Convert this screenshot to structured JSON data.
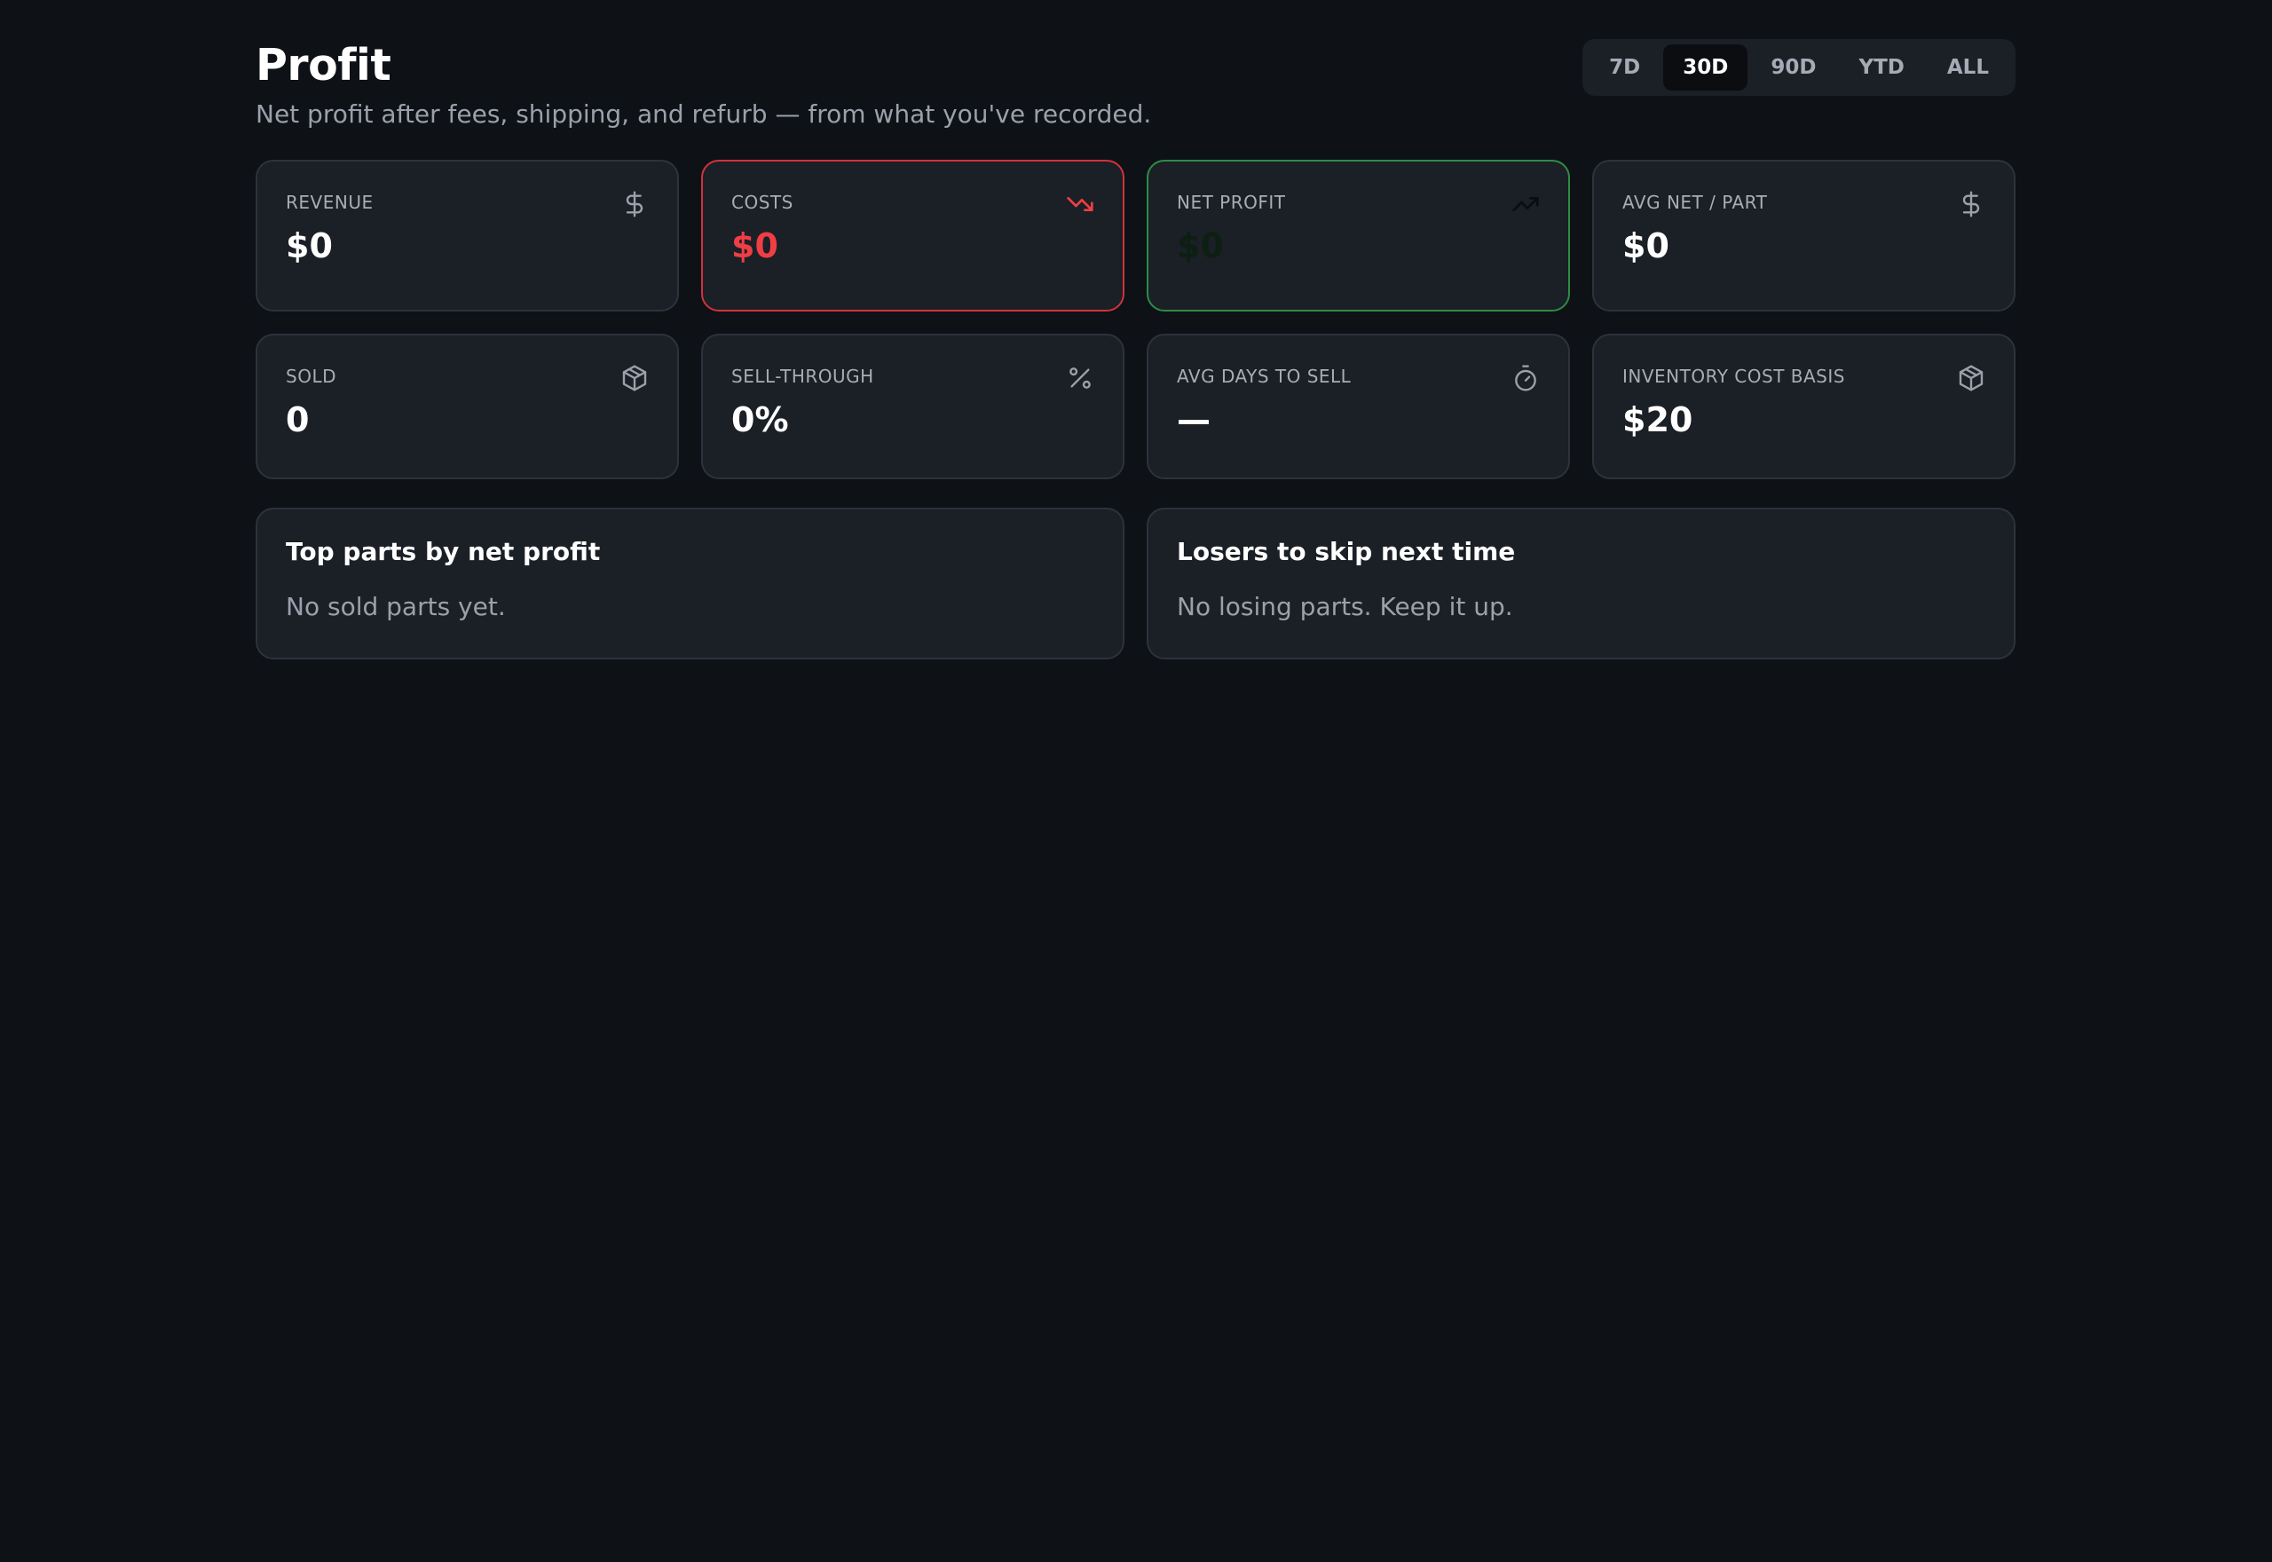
{
  "header": {
    "title": "Profit",
    "subtitle": "Net profit after fees, shipping, and refurb — from what you've recorded."
  },
  "range": {
    "options": [
      "7D",
      "30D",
      "90D",
      "YTD",
      "ALL"
    ],
    "selected": "30D"
  },
  "stats": [
    {
      "label": "Revenue",
      "value": "$0",
      "icon": "dollar-icon"
    },
    {
      "label": "Costs",
      "value": "$0",
      "icon": "trending-down-icon"
    },
    {
      "label": "Net profit",
      "value": "$0",
      "icon": "trending-up-icon"
    },
    {
      "label": "Avg net / part",
      "value": "$0",
      "icon": "dollar-icon"
    },
    {
      "label": "Sold",
      "value": "0",
      "icon": "package-icon"
    },
    {
      "label": "Sell-through",
      "value": "0%",
      "icon": "percent-icon"
    },
    {
      "label": "Avg days to sell",
      "value": "—",
      "icon": "timer-icon"
    },
    {
      "label": "Inventory cost basis",
      "value": "$20",
      "icon": "package-icon"
    }
  ],
  "panels": {
    "top": {
      "title": "Top parts by net profit",
      "empty": "No sold parts yet."
    },
    "losers": {
      "title": "Losers to skip next time",
      "empty": "No losing parts. Keep it up."
    }
  },
  "colors": {
    "background": "#0e1116",
    "card": "#1b1f26",
    "negative": "#ef3e45",
    "positive_border": "#2e8c45"
  }
}
